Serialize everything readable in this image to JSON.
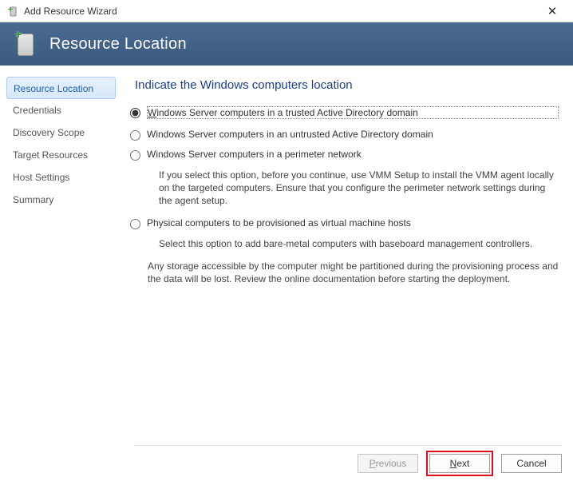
{
  "window": {
    "title": "Add Resource Wizard"
  },
  "banner": {
    "title": "Resource Location"
  },
  "sidebar": {
    "items": [
      {
        "label": "Resource Location",
        "selected": true
      },
      {
        "label": "Credentials",
        "selected": false
      },
      {
        "label": "Discovery Scope",
        "selected": false
      },
      {
        "label": "Target Resources",
        "selected": false
      },
      {
        "label": "Host Settings",
        "selected": false
      },
      {
        "label": "Summary",
        "selected": false
      }
    ]
  },
  "main": {
    "heading": "Indicate the Windows computers location",
    "options": [
      {
        "id": "trusted-domain",
        "label_prefix": "W",
        "label": "indows Server computers in a trusted Active Directory domain",
        "selected": true,
        "focused": true
      },
      {
        "id": "untrusted-domain",
        "label": "Windows Server computers in an untrusted Active Directory domain",
        "selected": false
      },
      {
        "id": "perimeter",
        "label": "Windows Server computers in a perimeter network",
        "selected": false,
        "description": "If you select this option, before you continue, use VMM Setup to install the VMM agent locally on the targeted computers. Ensure that you configure the perimeter network settings during the agent setup."
      },
      {
        "id": "physical",
        "label": "Physical computers to be provisioned as virtual machine hosts",
        "selected": false,
        "description": "Select this option to add bare-metal computers with baseboard management controllers.",
        "description2": "Any storage accessible by the computer might be partitioned during the provisioning process and the data will be lost. Review the online documentation before starting the deployment."
      }
    ]
  },
  "footer": {
    "previous_prefix": "P",
    "previous_label": "revious",
    "next_prefix": "N",
    "next_label": "ext",
    "cancel_label": "Cancel",
    "previous_enabled": false
  }
}
